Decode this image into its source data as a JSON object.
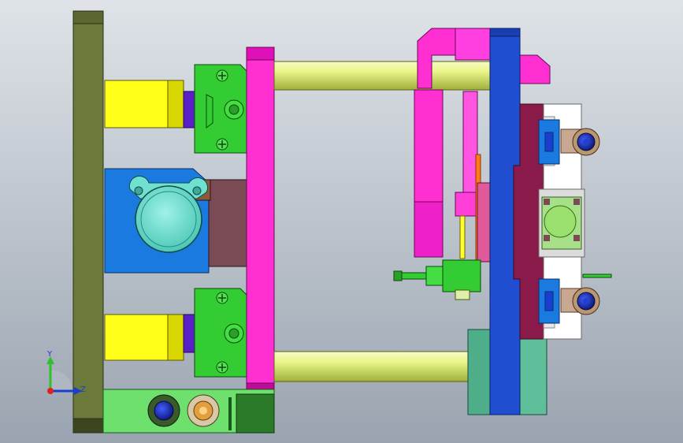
{
  "viewport": {
    "background_top": "#dfe3e8",
    "background_bottom": "#9aa4b0"
  },
  "triad": {
    "y_label": "Y",
    "z_label": "Z",
    "y_color": "#2fbf2f",
    "z_color": "#1a3fd0",
    "origin_color": "#e02020"
  },
  "colors": {
    "clamp_plate": "#6b7a3a",
    "top_plate_magenta": "#ff2fd2",
    "tie_bar": "#e8f58c",
    "cylinder_yellow": "#ffff1a",
    "mount_green": "#33cc33",
    "bracket_purple": "#5a20c8",
    "block_blue": "#1a7ae0",
    "flange_cyan": "#70e0d0",
    "block_maroon": "#7a4a55",
    "moving_platen": "#1f4fd0",
    "mold_plate": "#8a1a4a",
    "cooling_green": "#5fbf9a",
    "base_green": "#6ee06e"
  },
  "icons": [
    "triad-icon"
  ]
}
